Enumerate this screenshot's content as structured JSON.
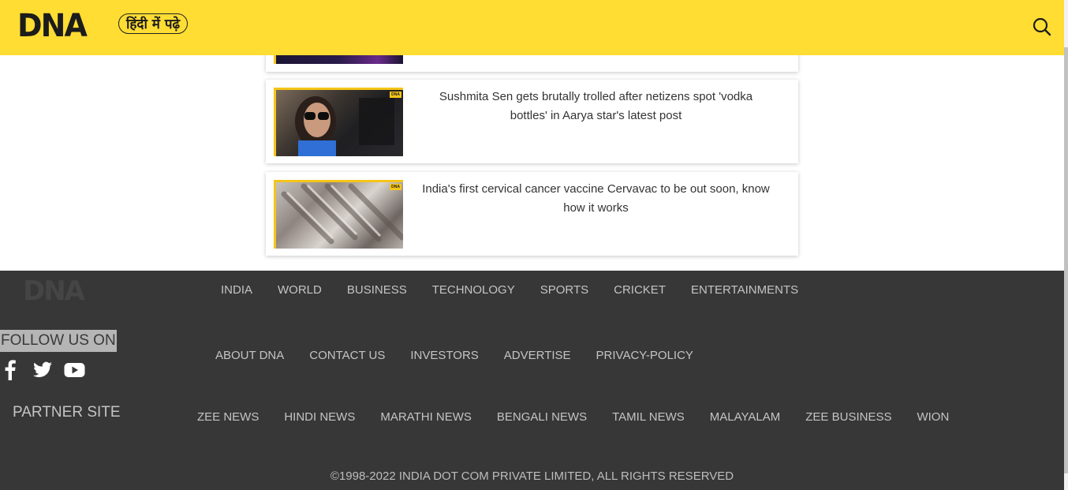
{
  "header": {
    "logo": "DNA",
    "language_button": "हिंदी में पढ़े",
    "search_icon": "search-icon",
    "background_color": "#ffdd33"
  },
  "articles": [
    {
      "headline": "Sushmita Sen gets brutally trolled after netizens spot 'vodka bottles' in Aarya star's latest post",
      "thumb_tag": "DNA"
    },
    {
      "headline": "India's first cervical cancer vaccine Cervavac to be out soon, know how it works",
      "thumb_tag": "DNA"
    }
  ],
  "footer": {
    "logo": "DNA",
    "background_color": "#373737",
    "nav_primary": [
      "INDIA",
      "WORLD",
      "BUSINESS",
      "TECHNOLOGY",
      "SPORTS",
      "CRICKET",
      "ENTERTAINMENTS"
    ],
    "nav_company": [
      "ABOUT DNA",
      "CONTACT US",
      "INVESTORS",
      "ADVERTISE",
      "PRIVACY-POLICY"
    ],
    "follow_label": "FOLLOW US ON",
    "social_icons": [
      "facebook-icon",
      "twitter-icon",
      "youtube-icon"
    ],
    "partner_label": "PARTNER SITE",
    "partner_sites": [
      "ZEE NEWS",
      "HINDI NEWS",
      "MARATHI NEWS",
      "BENGALI NEWS",
      "TAMIL NEWS",
      "MALAYALAM",
      "ZEE BUSINESS",
      "WION"
    ],
    "copyright": "©1998-2022 INDIA DOT COM PRIVATE LIMITED, ALL RIGHTS RESERVED"
  }
}
